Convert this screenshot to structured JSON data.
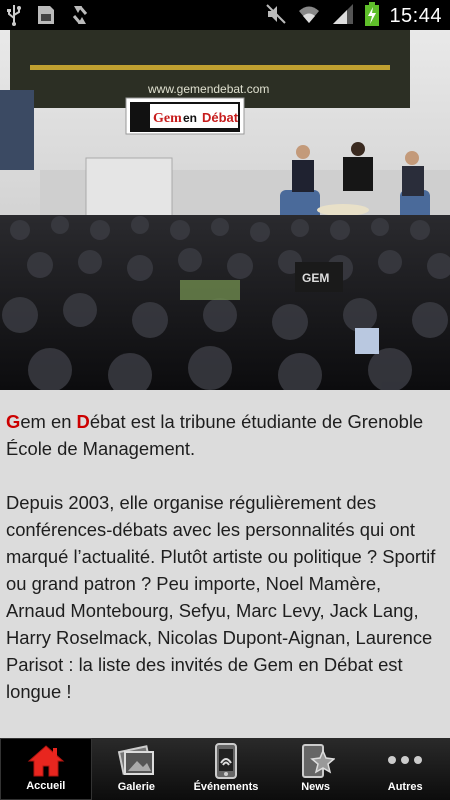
{
  "status_bar": {
    "time": "15:44",
    "left_icons": [
      "usb-icon",
      "sd-card-icon",
      "sync-icon"
    ],
    "right_icons": [
      "mute-icon",
      "wifi-icon",
      "signal-icon",
      "battery-charging-icon"
    ]
  },
  "photo": {
    "screen_url": "www.gemendebat.com",
    "banner_gem": "Gem",
    "banner_en": "en",
    "banner_debat": "Débat",
    "shirt_text": "GEM"
  },
  "content": {
    "p1_letter_g": "G",
    "p1_em": "em en ",
    "p1_letter_d": "D",
    "p1_rest_title": "ébat",
    "p1_rest": " est la tribune étudiante de Grenoble École de Management.",
    "p2": "Depuis 2003, elle organise régulièrement des conférences-débats avec les personnalités qui ont marqué l’actualité. Plutôt artiste ou politique ? Sportif ou grand patron ? Peu importe, Noel Mamère, Arnaud Montebourg, Sefyu, Marc Levy, Jack Lang, Harry Roselmack, Nicolas Dupont-Aignan, Laurence Parisot : la liste des invités de Gem en Débat est longue !"
  },
  "tabs": [
    {
      "label": "Accueil",
      "icon": "home-icon",
      "active": true
    },
    {
      "label": "Galerie",
      "icon": "gallery-icon",
      "active": false
    },
    {
      "label": "Événements",
      "icon": "events-phone-icon",
      "active": false
    },
    {
      "label": "News",
      "icon": "news-star-icon",
      "active": false
    },
    {
      "label": "Autres",
      "icon": "more-dots-icon",
      "active": false
    }
  ],
  "colors": {
    "accent": "#cc0000",
    "home_icon": "#e8261f",
    "background": "#dcdcdc"
  }
}
